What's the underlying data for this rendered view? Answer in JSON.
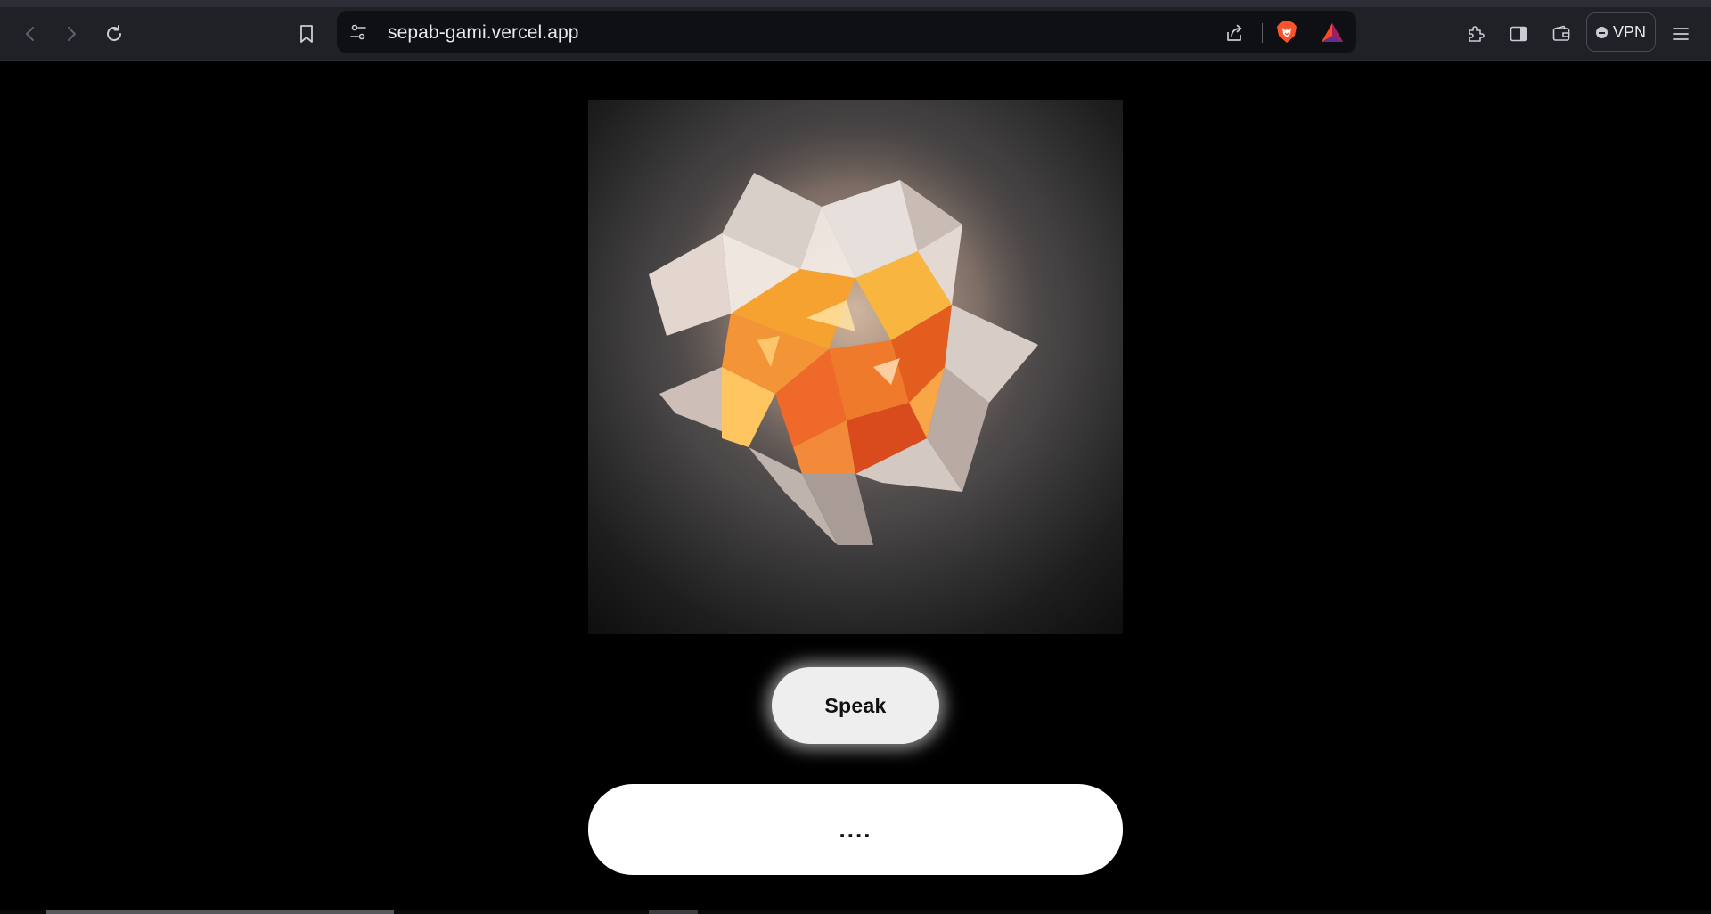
{
  "browser": {
    "url": "sepab-gami.vercel.app",
    "vpn_label": "VPN",
    "icons": {
      "back": "arrow-left-icon",
      "forward": "arrow-right-icon",
      "reload": "reload-icon",
      "bookmark": "bookmark-icon",
      "site_settings": "tune-icon",
      "share": "share-icon",
      "brave_shields": "brave-lion-icon",
      "rewards": "bat-triangle-icon",
      "extensions": "puzzle-icon",
      "sidebar": "sidebar-icon",
      "wallet": "wallet-icon",
      "menu": "hamburger-menu-icon"
    }
  },
  "page": {
    "hero_image": "orange-crystal-image",
    "speak_label": "Speak",
    "transcript_text": "...."
  },
  "colors": {
    "page_background": "#000000",
    "chrome_background": "#1f2127",
    "button_background": "#eeeeee",
    "crystal_accent": "#f28a2a"
  }
}
